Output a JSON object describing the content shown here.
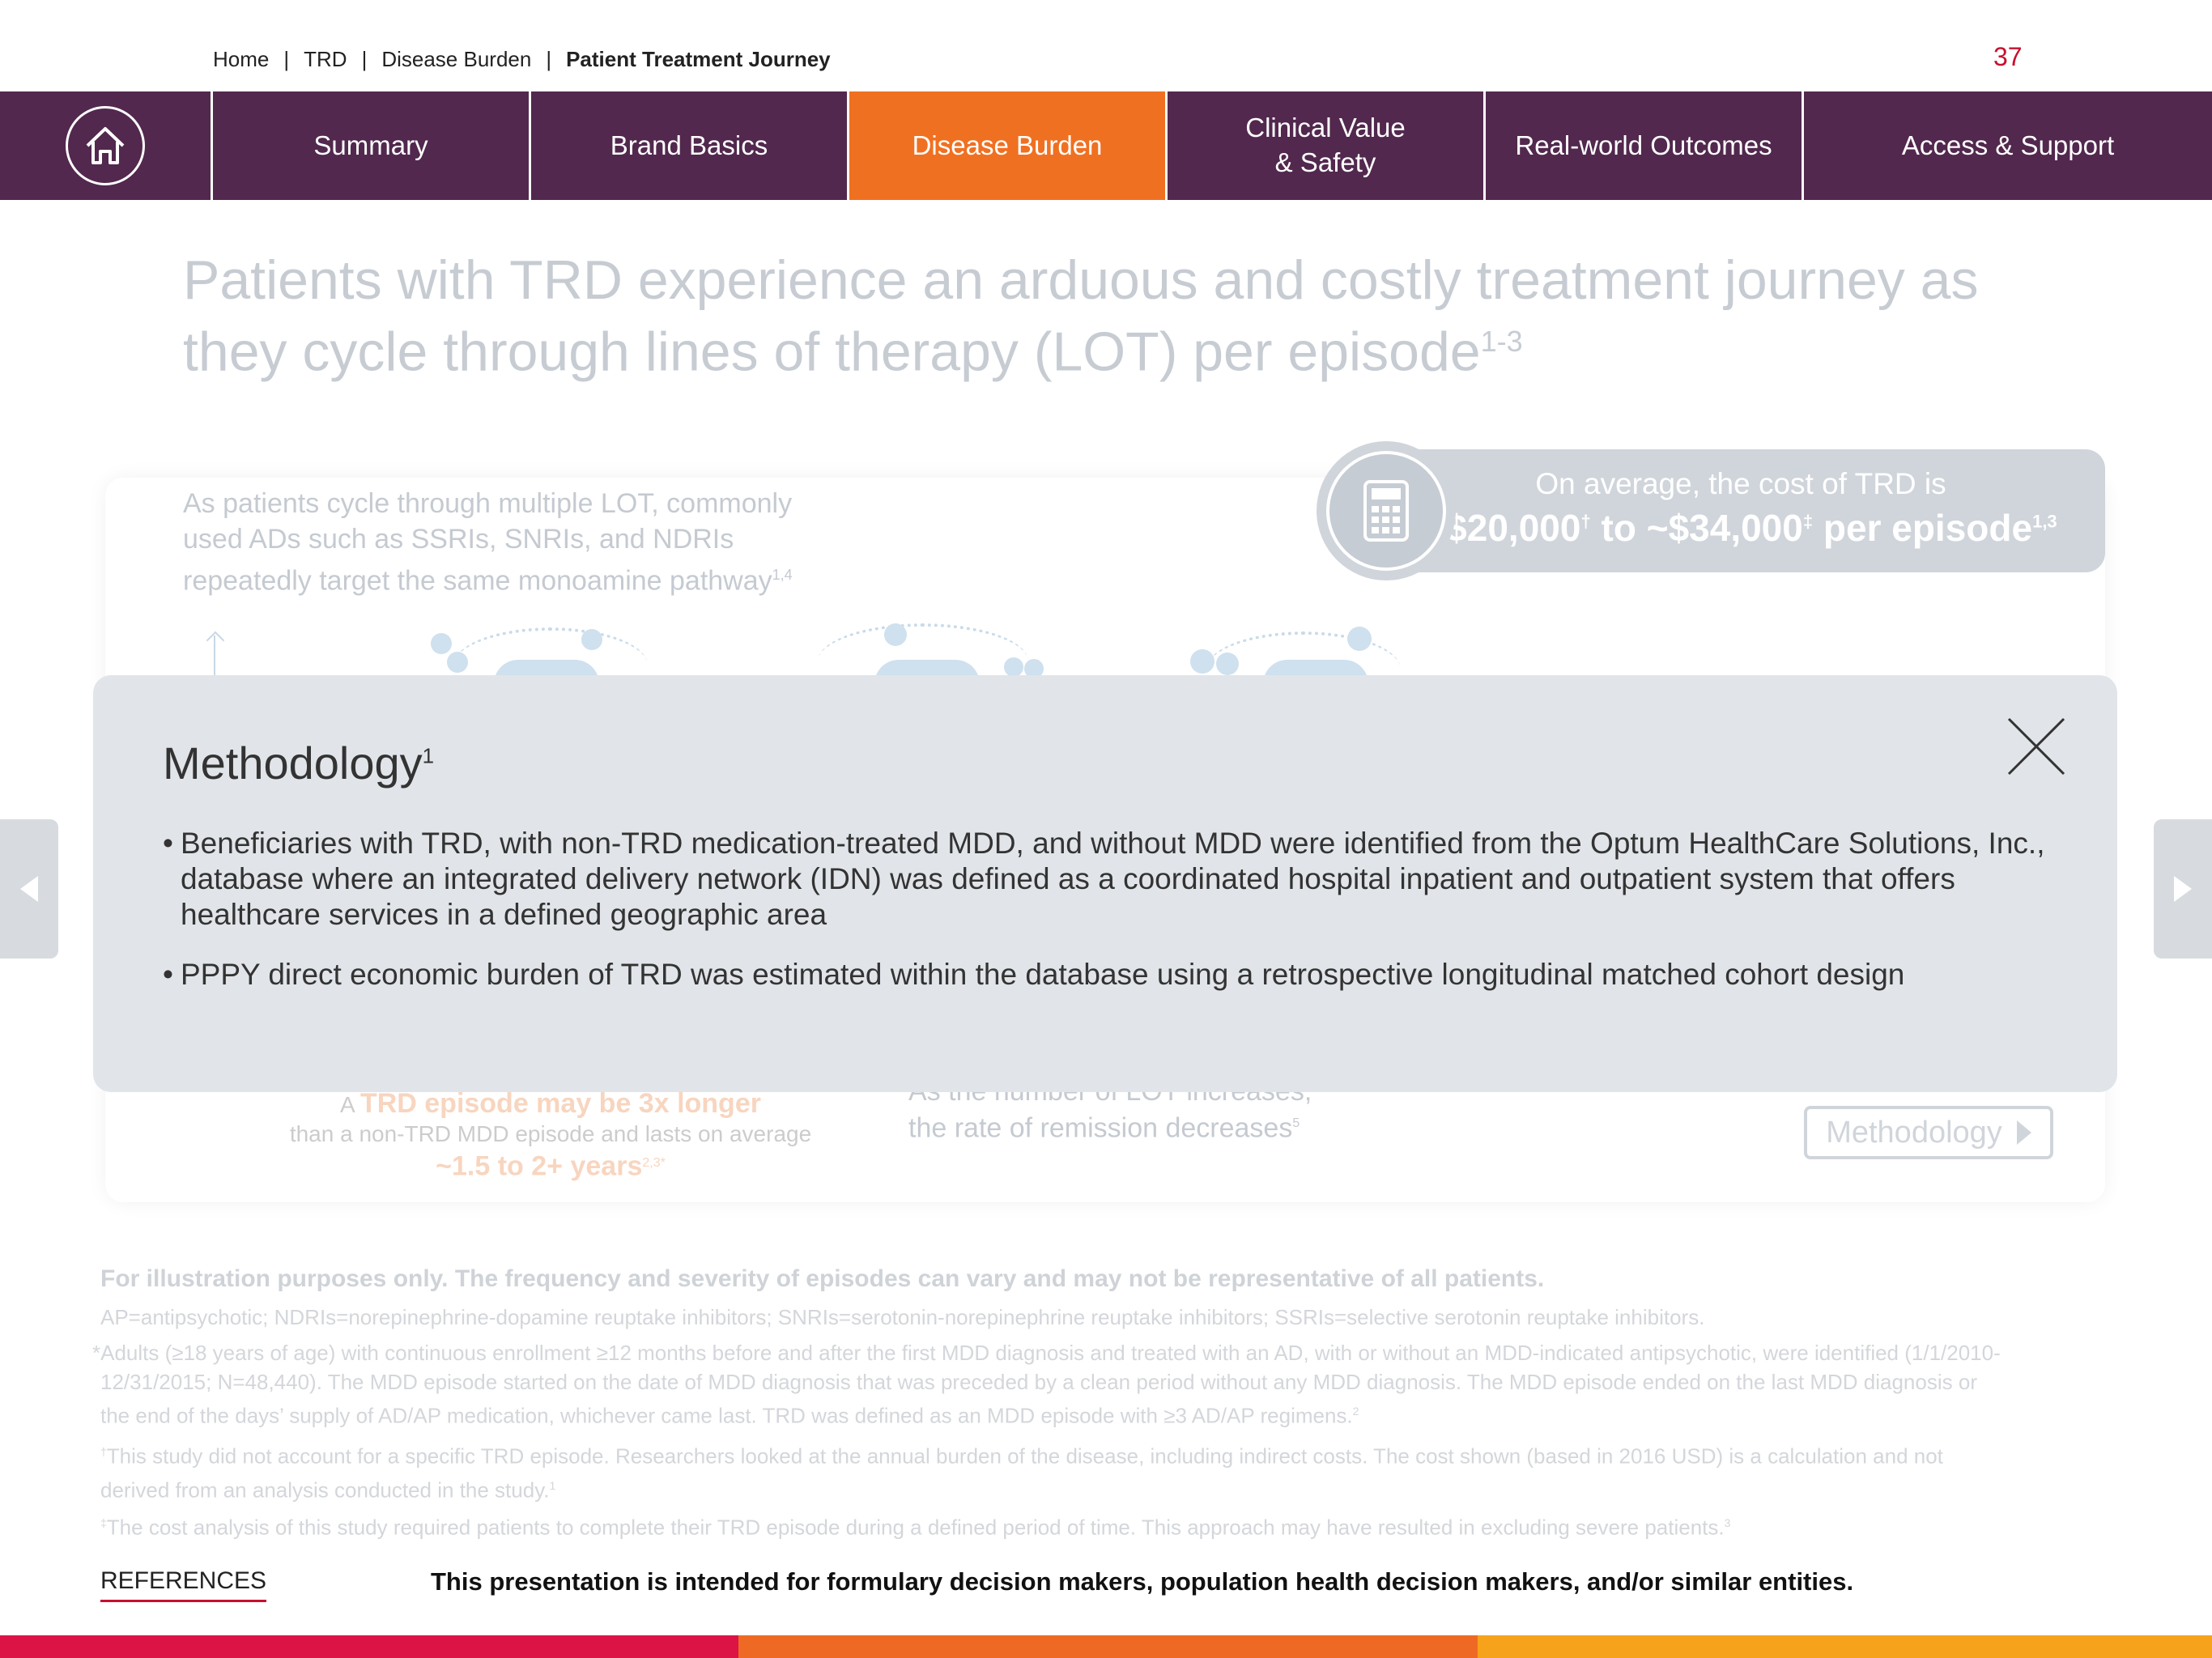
{
  "breadcrumb": {
    "items": [
      "Home",
      "TRD",
      "Disease Burden"
    ],
    "current": "Patient Treatment Journey",
    "separator": "|"
  },
  "page_number": "37",
  "nav": {
    "home_icon": "home-icon",
    "tabs": [
      {
        "label": "Summary"
      },
      {
        "label": "Brand Basics"
      },
      {
        "label": "Disease Burden",
        "active": true
      },
      {
        "label": "Clinical Value\n& Safety"
      },
      {
        "label": "Real-world Outcomes"
      },
      {
        "label": "Access & Support"
      }
    ]
  },
  "headline": {
    "text": "Patients with TRD experience an arduous and costly treatment journey as they cycle through lines of therapy (LOT) per episode",
    "sup": "1-3"
  },
  "intro": {
    "text": "As patients cycle through multiple LOT, commonly used ADs such as SSRIs, SNRIs, and NDRIs repeatedly target the same monoamine pathway",
    "sup": "1,4"
  },
  "cost": {
    "line1": "On average, the cost of TRD is",
    "low": "~$20,000",
    "low_sup": "†",
    "mid": " to ",
    "high": "~$34,000",
    "high_sup": "‡",
    "tail": " per episode",
    "tail_sup": "1,3",
    "icon": "calculator-icon"
  },
  "episode": {
    "prefix": "A ",
    "highlight": "TRD episode may be 3x longer",
    "line2": "than a non-TRD MDD episode and lasts on average",
    "duration": "~1.5 to 2+ years",
    "duration_sup": "2,3*"
  },
  "remission": {
    "line1": "As the number of LOT increases,",
    "line2": "the rate of remission decreases",
    "sup": "5"
  },
  "methodology_button": "Methodology",
  "illustration_note": "For illustration purposes only. The frequency and severity of episodes can vary and may not be representative of all patients.",
  "abbreviations": "AP=antipsychotic; NDRIs=norepinephrine-dopamine reuptake inhibitors; SNRIs=serotonin-norepinephrine reuptake inhibitors; SSRIs=selective serotonin reuptake inhibitors.",
  "footnotes": {
    "star_mark": "*",
    "star": "Adults (≥18 years of age) with continuous enrollment ≥12 months before and after the first MDD diagnosis and treated with an AD, with or without an MDD-indicated antipsychotic, were identified (1/1/2010-12/31/2015; N=48,440). The MDD episode started on the date of MDD diagnosis that was preceded by a clean period without any MDD diagnosis. The MDD episode ended on the last MDD diagnosis or the end of the days’ supply of AD/AP medication, whichever came last. TRD was defined as an MDD episode with ≥3 AD/AP regimens.",
    "star_sup": "2",
    "dagger_mark": "†",
    "dagger": "This study did not account for a specific TRD episode. Researchers looked at the annual burden of the disease, including indirect costs. The cost shown (based in 2016 USD) is a calculation and not derived from an analysis conducted in the study.",
    "dagger_sup": "1",
    "ddagger_mark": "‡",
    "ddagger": "The cost analysis of this study required patients to complete their TRD episode during a defined period of time. This approach may have resulted in excluding severe patients.",
    "ddagger_sup": "3"
  },
  "references_label": "REFERENCES",
  "disclaimer": "This presentation is intended for formulary decision makers, population health decision makers, and/or similar entities.",
  "modal": {
    "title": "Methodology",
    "title_sup": "1",
    "bullets": [
      "Beneficiaries with TRD, with non-TRD medication-treated MDD, and without MDD were identified from the Optum HealthCare Solutions, Inc., database where an integrated delivery network (IDN) was defined as a coordinated hospital inpatient and outpatient system that offers healthcare services in a defined geographic area",
      "PPPY direct economic burden of TRD was estimated within the database using a retrospective longitudinal matched cohort design"
    ],
    "close_icon": "close-icon"
  },
  "colors": {
    "nav_bg": "#52284e",
    "nav_active": "#f07021",
    "page_number": "#c8102e",
    "bottom_bar": [
      "#dc1446",
      "#ee6a24",
      "#f7a21b"
    ]
  }
}
